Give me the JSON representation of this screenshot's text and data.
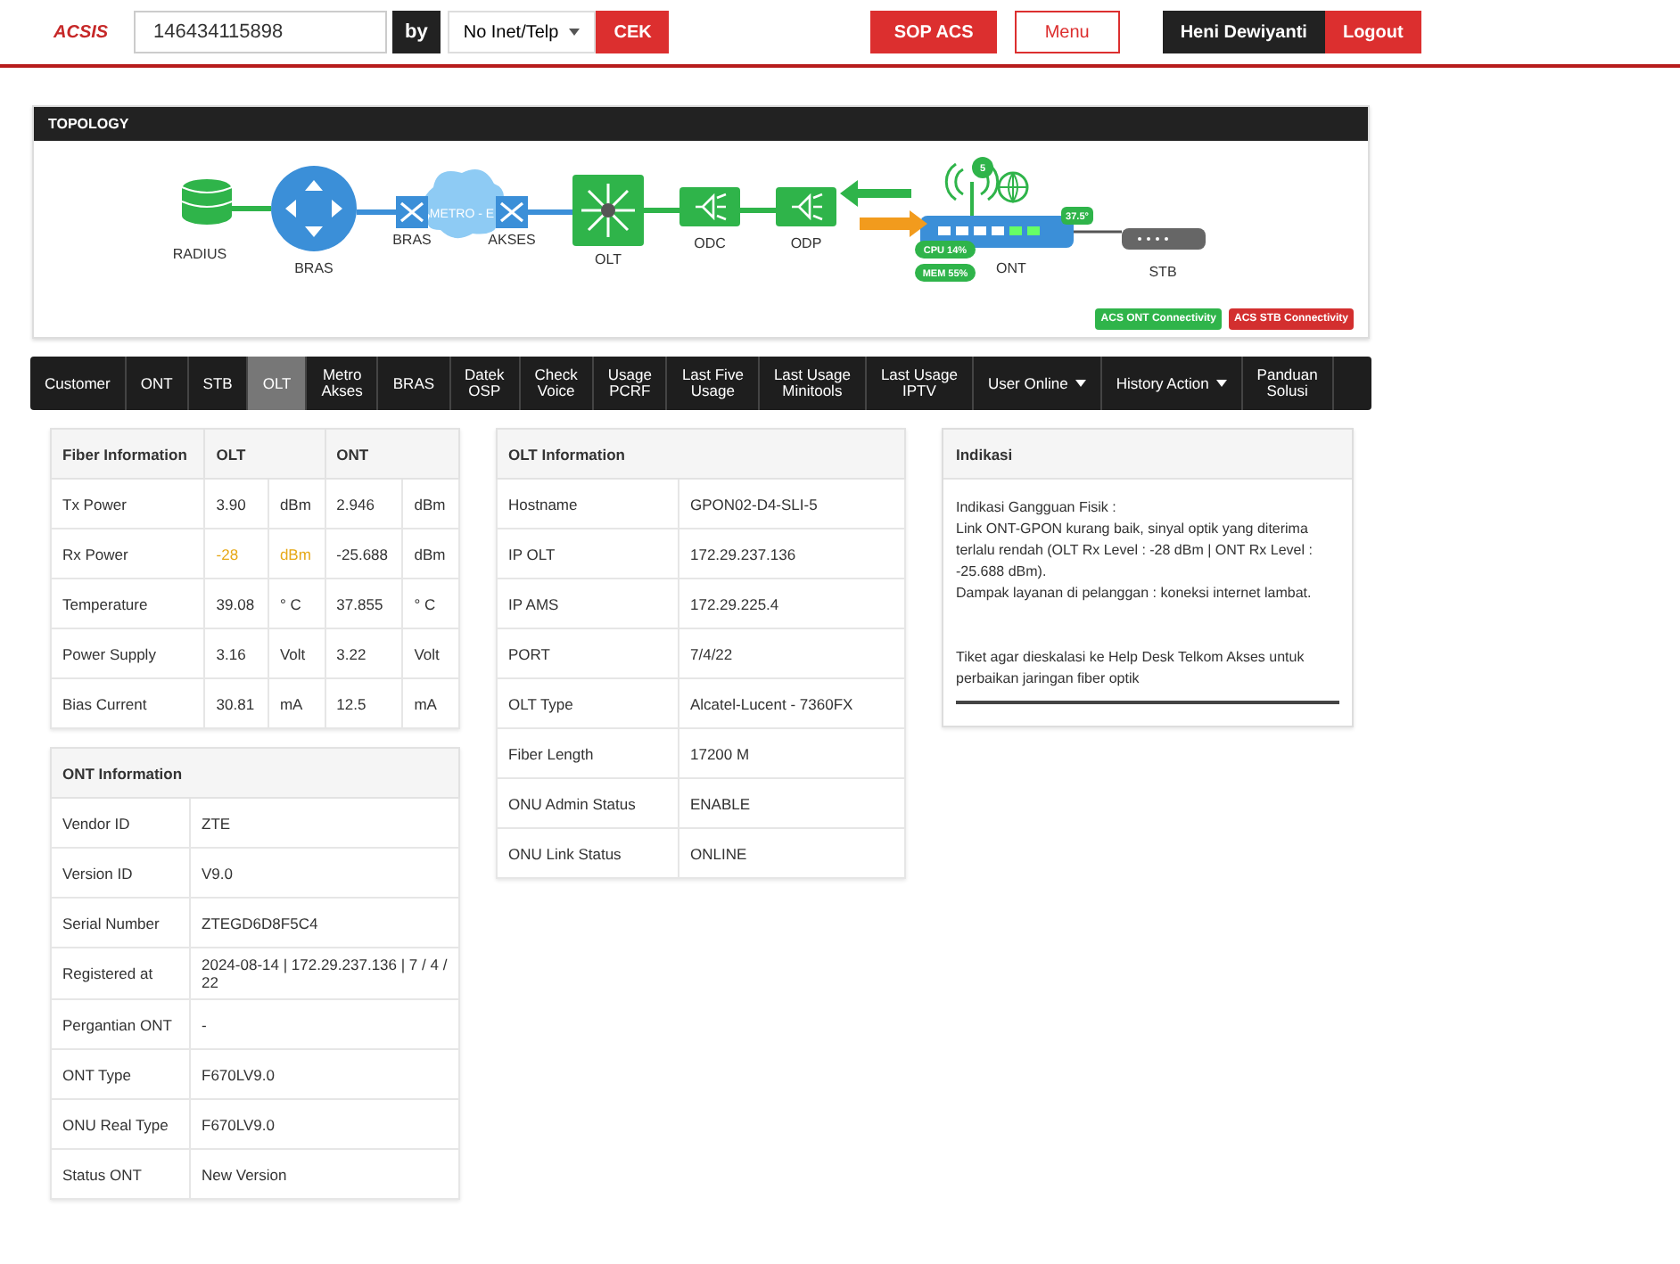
{
  "header": {
    "logo": "ACSIS",
    "search_value": "146434115898",
    "by_label": "by",
    "search_type": "No Inet/Telp",
    "check_button": "CEK",
    "sop_button": "SOP ACS",
    "menu_button": "Menu",
    "user_name": "Heni Dewiyanti",
    "logout_button": "Logout"
  },
  "topology": {
    "title": "TOPOLOGY",
    "metro_label": "METRO - E",
    "nodes": [
      {
        "kind": "radius",
        "label": "RADIUS"
      },
      {
        "kind": "router",
        "label": "BRAS"
      },
      {
        "kind": "switch",
        "label": "BRAS"
      },
      {
        "kind": "switch",
        "label": "AKSES"
      },
      {
        "kind": "olt",
        "label": "OLT"
      },
      {
        "kind": "splitter",
        "label": "ODC"
      },
      {
        "kind": "splitter",
        "label": "ODP"
      },
      {
        "kind": "ont",
        "label": "ONT"
      },
      {
        "kind": "stb",
        "label": "STB"
      }
    ],
    "ont_status": {
      "wifi_clients": "5",
      "temperature": "37.5°",
      "cpu": "CPU 14%",
      "mem": "MEM 55%"
    },
    "legend": [
      {
        "label": "ACS ONT Connectivity",
        "color": "#2fb44a"
      },
      {
        "label": "ACS STB Connectivity",
        "color": "#d32f2f"
      }
    ]
  },
  "tabs": [
    {
      "label": "Customer",
      "selected": false,
      "dropdown": false
    },
    {
      "label": "ONT",
      "selected": false,
      "dropdown": false
    },
    {
      "label": "STB",
      "selected": false,
      "dropdown": false
    },
    {
      "label": "OLT",
      "selected": true,
      "dropdown": false
    },
    {
      "label": "Metro\nAkses",
      "selected": false,
      "dropdown": false
    },
    {
      "label": "BRAS",
      "selected": false,
      "dropdown": false
    },
    {
      "label": "Datek\nOSP",
      "selected": false,
      "dropdown": false
    },
    {
      "label": "Check\nVoice",
      "selected": false,
      "dropdown": false
    },
    {
      "label": "Usage\nPCRF",
      "selected": false,
      "dropdown": false
    },
    {
      "label": "Last Five\nUsage",
      "selected": false,
      "dropdown": false
    },
    {
      "label": "Last Usage\nMinitools",
      "selected": false,
      "dropdown": false
    },
    {
      "label": "Last Usage\nIPTV",
      "selected": false,
      "dropdown": false
    },
    {
      "label": "User Online",
      "selected": false,
      "dropdown": true
    },
    {
      "label": "History Action",
      "selected": false,
      "dropdown": true
    },
    {
      "label": "Panduan\nSolusi",
      "selected": false,
      "dropdown": false
    }
  ],
  "fiber_information": {
    "columns": [
      "Fiber Information",
      "OLT",
      "ONT"
    ],
    "rows": [
      {
        "label": "Tx Power",
        "olt_value": "3.90",
        "olt_unit": "dBm",
        "ont_value": "2.946",
        "ont_unit": "dBm",
        "warning": false
      },
      {
        "label": "Rx Power",
        "olt_value": "-28",
        "olt_unit": "dBm",
        "ont_value": "-25.688",
        "ont_unit": "dBm",
        "warning": true
      },
      {
        "label": "Temperature",
        "olt_value": "39.08",
        "olt_unit": "° C",
        "ont_value": "37.855",
        "ont_unit": "° C",
        "warning": false
      },
      {
        "label": "Power Supply",
        "olt_value": "3.16",
        "olt_unit": "Volt",
        "ont_value": "3.22",
        "ont_unit": "Volt",
        "warning": false
      },
      {
        "label": "Bias Current",
        "olt_value": "30.81",
        "olt_unit": "mA",
        "ont_value": "12.5",
        "ont_unit": "mA",
        "warning": false
      }
    ]
  },
  "ont_information": {
    "title": "ONT Information",
    "rows": [
      {
        "label": "Vendor ID",
        "value": "ZTE"
      },
      {
        "label": "Version ID",
        "value": "V9.0"
      },
      {
        "label": "Serial Number",
        "value": "ZTEGD6D8F5C4"
      },
      {
        "label": "Registered at",
        "value": "2024-08-14 | 172.29.237.136 | 7 / 4 / 22"
      },
      {
        "label": "Pergantian ONT",
        "value": "-"
      },
      {
        "label": "ONT Type",
        "value": "F670LV9.0"
      },
      {
        "label": "ONU Real Type",
        "value": "F670LV9.0"
      },
      {
        "label": "Status ONT",
        "value": "New Version"
      }
    ]
  },
  "olt_information": {
    "title": "OLT Information",
    "rows": [
      {
        "label": "Hostname",
        "value": "GPON02-D4-SLI-5"
      },
      {
        "label": "IP OLT",
        "value": "172.29.237.136"
      },
      {
        "label": "IP AMS",
        "value": "172.29.225.4"
      },
      {
        "label": "PORT",
        "value": "7/4/22"
      },
      {
        "label": "OLT Type",
        "value": "Alcatel-Lucent - 7360FX"
      },
      {
        "label": "Fiber Length",
        "value": "17200 M"
      },
      {
        "label": "ONU Admin Status",
        "value": "ENABLE"
      },
      {
        "label": "ONU Link Status",
        "value": "ONLINE"
      }
    ]
  },
  "indikasi": {
    "title": "Indikasi",
    "paragraphs": [
      "Indikasi Gangguan Fisik :\nLink ONT-GPON kurang baik, sinyal optik yang diterima terlalu rendah (OLT Rx Level : -28 dBm | ONT Rx Level : -25.688 dBm).\nDampak layanan di pelanggan : koneksi internet lambat.",
      "Tiket agar dieskalasi ke Help Desk Telkom Akses untuk perbaikan jaringan fiber optik"
    ]
  }
}
